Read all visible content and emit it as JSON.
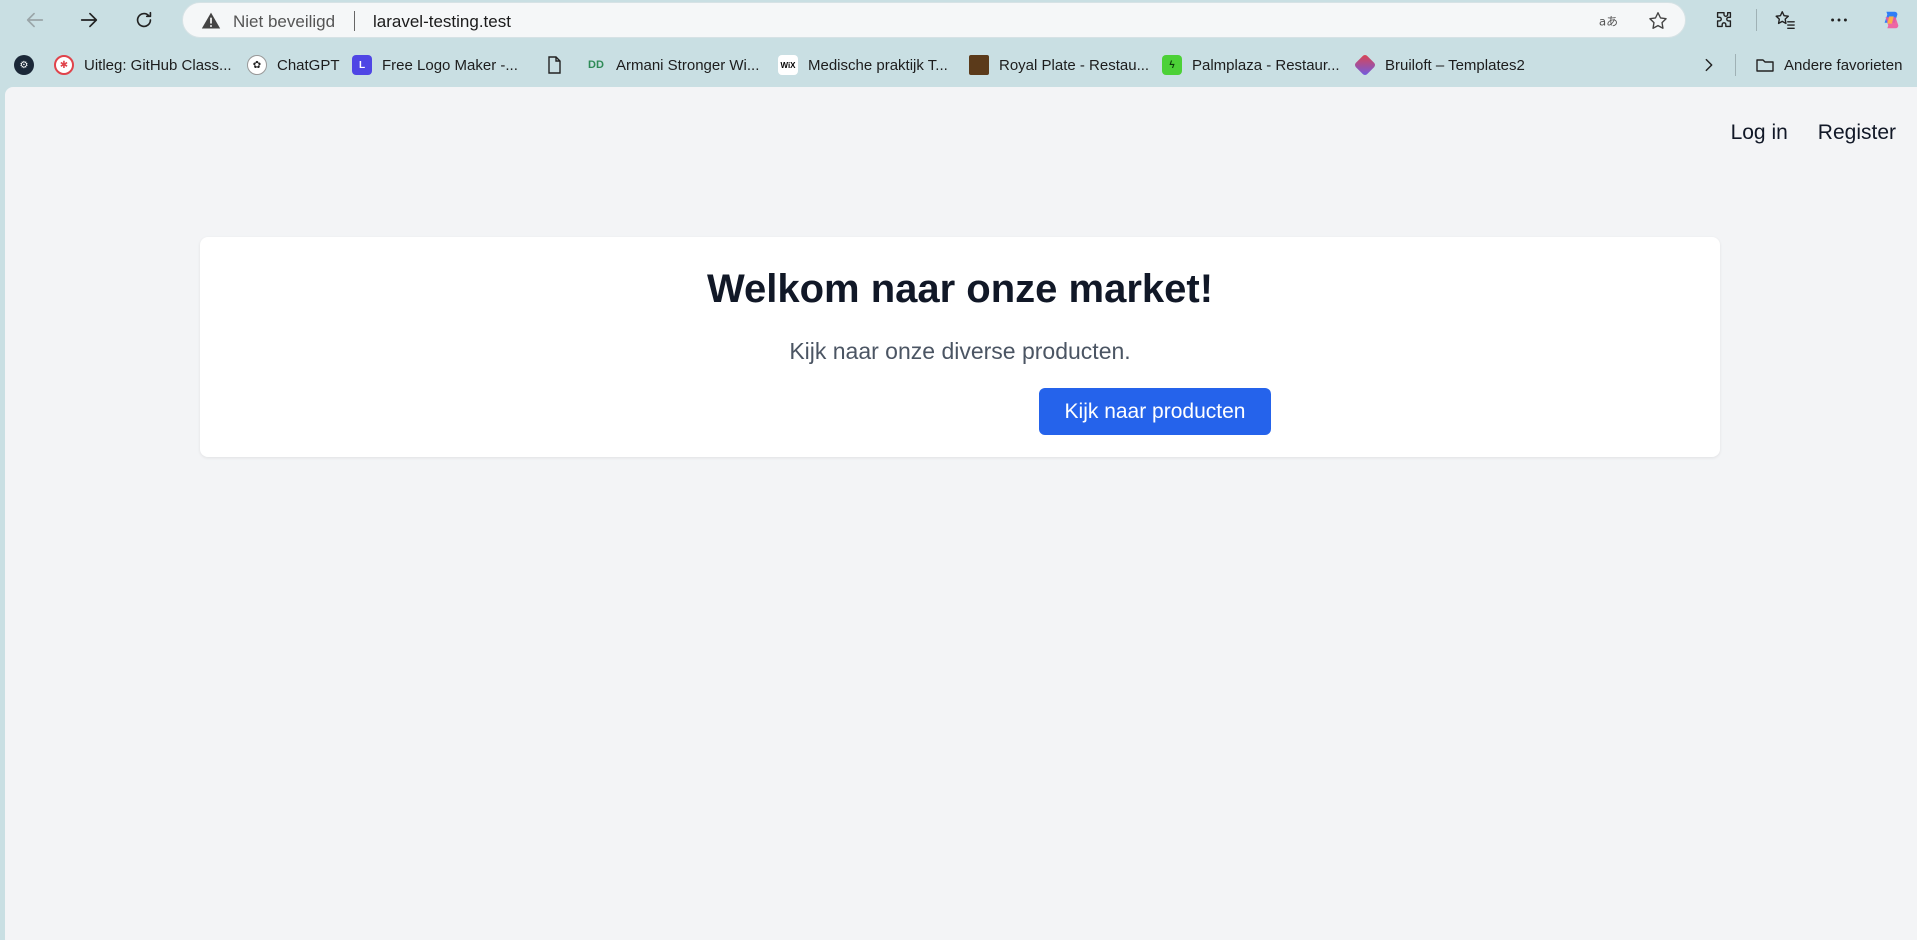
{
  "browser": {
    "security_label": "Niet beveiligd",
    "url": "laravel-testing.test"
  },
  "bookmarks": [
    {
      "label": "Uitleg: GitHub Class...",
      "icon": "github-classroom-icon"
    },
    {
      "label": "ChatGPT",
      "icon": "chatgpt-icon"
    },
    {
      "label": "Free Logo Maker -...",
      "icon": "logo-maker-icon"
    },
    {
      "label": "",
      "icon": "document-icon"
    },
    {
      "label": "Armani Stronger Wi...",
      "icon": "armani-icon"
    },
    {
      "label": "Medische praktijk T...",
      "icon": "wix-icon"
    },
    {
      "label": "Royal Plate - Restau...",
      "icon": "royal-plate-icon"
    },
    {
      "label": "Palmplaza - Restaur...",
      "icon": "palmplaza-icon"
    },
    {
      "label": "Bruiloft – Templates2",
      "icon": "bruiloft-icon"
    }
  ],
  "other_favorites": "Andere favorieten",
  "nav": {
    "login": "Log in",
    "register": "Register"
  },
  "hero": {
    "title": "Welkom naar onze market!",
    "subtitle": "Kijk naar onze diverse producten.",
    "button": "Kijk naar producten"
  },
  "colors": {
    "accent": "#2563eb",
    "page_bg": "#f3f4f6",
    "chrome_bg": "#c9dfe3"
  }
}
